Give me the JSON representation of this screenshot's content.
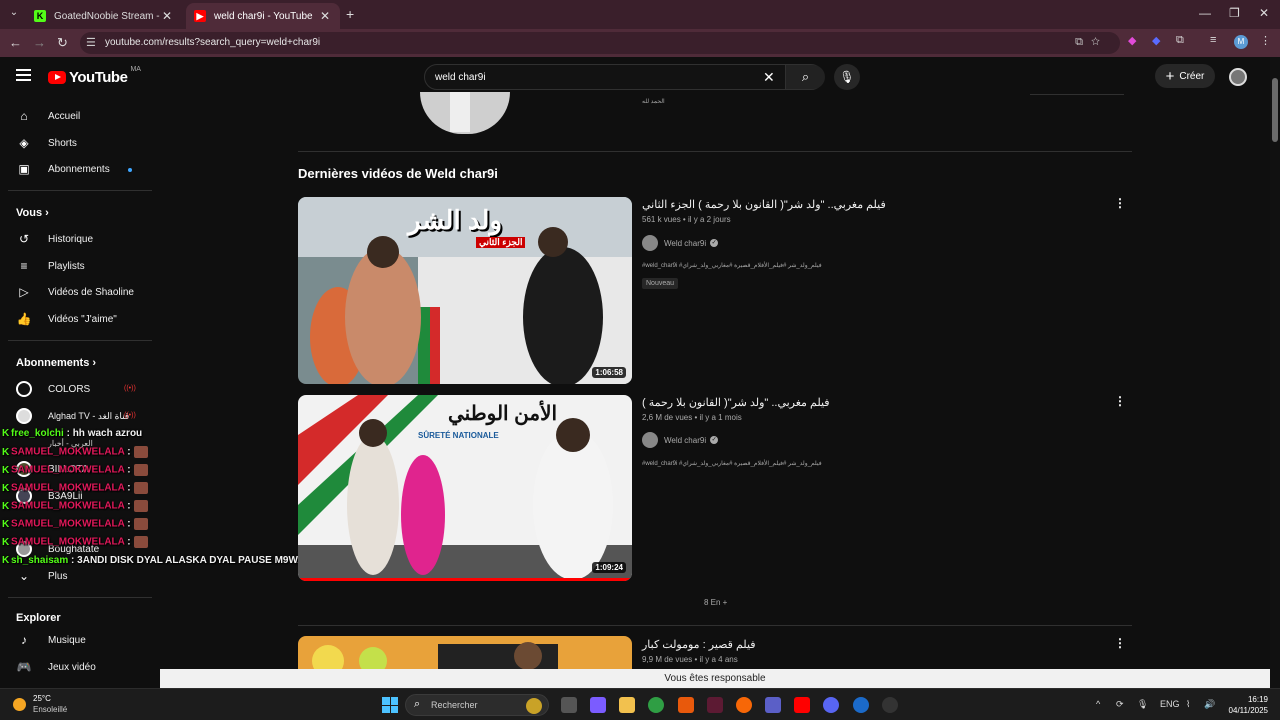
{
  "browser": {
    "tabs": [
      {
        "title": "GoatedNoobie Stream - Watch",
        "favicon": "kick-icon",
        "color": "#53fc18"
      },
      {
        "title": "weld char9i - YouTube",
        "favicon": "youtube-icon",
        "color": "#ff0000",
        "active": true
      }
    ],
    "url": "youtube.com/results?search_query=weld+char9i"
  },
  "youtube": {
    "logo_word": "YouTube",
    "region": "MA",
    "search_query": "weld char9i",
    "create_label": "Créer"
  },
  "sidebar": {
    "main": [
      {
        "label": "Accueil",
        "icon": "home-icon"
      },
      {
        "label": "Shorts",
        "icon": "shorts-icon"
      },
      {
        "label": "Abonnements",
        "icon": "subscriptions-icon"
      }
    ],
    "you_header": "Vous",
    "you": [
      {
        "label": "Historique",
        "icon": "history-icon"
      },
      {
        "label": "Playlists",
        "icon": "playlists-icon"
      },
      {
        "label": "Vidéos de Shaoline",
        "icon": "your-videos-icon"
      },
      {
        "label": "Vidéos \"J'aime\"",
        "icon": "like-icon"
      }
    ],
    "subs_header": "Abonnements",
    "subs": [
      {
        "label": "COLORS"
      },
      {
        "label": "Alghad TV - قناة الغد"
      },
      {
        "label": "العربي - أخبار"
      },
      {
        "label": "BILLOTA"
      },
      {
        "label": "B3A9Lii"
      },
      {
        "label": "Boughatate"
      }
    ],
    "more_label": "Plus",
    "explore_header": "Explorer",
    "explore": [
      {
        "label": "Musique",
        "icon": "music-icon"
      },
      {
        "label": "Jeux vidéo",
        "icon": "gaming-icon"
      }
    ]
  },
  "chat": [
    {
      "user": "free_kolchi",
      "msg": ": hh wach azrou",
      "color": "green"
    },
    {
      "user": "SAMUEL_MOKWELALA",
      "msg": ":",
      "color": "red"
    },
    {
      "user": "SAMUEL_MOKWELALA",
      "msg": ":",
      "color": "red"
    },
    {
      "user": "SAMUEL_MOKWELALA",
      "msg": ":",
      "color": "red"
    },
    {
      "user": "SAMUEL_MOKWELALA",
      "msg": ":",
      "color": "red"
    },
    {
      "user": "SAMUEL_MOKWELALA",
      "msg": ":",
      "color": "red"
    },
    {
      "user": "SAMUEL_MOKWELALA",
      "msg": ":",
      "color": "red"
    },
    {
      "user": "sh_shaisam",
      "msg": ": 3ANDI DISK DYAL ALASKA DYAL PAUSE M9WAD",
      "color": "green"
    }
  ],
  "results": {
    "top_caption": "الحمد لله",
    "section_title": "Dernières vidéos de Weld char9i",
    "videos": [
      {
        "title": "فيلم مغربي.. \"ولد شر\"( القانون بلا رحمة ) الجزء الثاني",
        "views": "561 k vues",
        "age": "il y a 2 jours",
        "channel": "Weld char9i",
        "desc": "#weld_char9i #فيلم_ولد_شر #فيلم_الأفلام_قصيرة #مغاربي_ولد_شراي",
        "badge": "Nouveau",
        "duration": "1:06:58",
        "thumb_text": "ولد الشر",
        "thumb_sub": "الجزء الثاني"
      },
      {
        "title": "فيلم مغربي.. \"ولد شر\"( القانون بلا رحمة )",
        "views": "2,6 M de vues",
        "age": "il y a 1 mois",
        "channel": "Weld char9i",
        "desc": "#weld_char9i #فيلم_ولد_شر #فيلم_الأفلام_قصيرة #مغاربي_ولد_شراي",
        "duration": "1:09:24",
        "thumb_text": "الأمن الوطني",
        "thumb_sub": "SÛRETÉ NATIONALE",
        "watched_fraction": 1.0
      },
      {
        "title": "فيلم قصير : مومولت كبار",
        "views": "9,9 M de vues",
        "age": "il y a 4 ans"
      }
    ],
    "more_label": "8 En +"
  },
  "toast": "Vous êtes responsable",
  "taskbar": {
    "temp": "25°C",
    "condition": "Ensoleillé",
    "search_placeholder": "Rechercher",
    "lang": "ENG",
    "time": "16:19",
    "date": "04/11/2025"
  }
}
